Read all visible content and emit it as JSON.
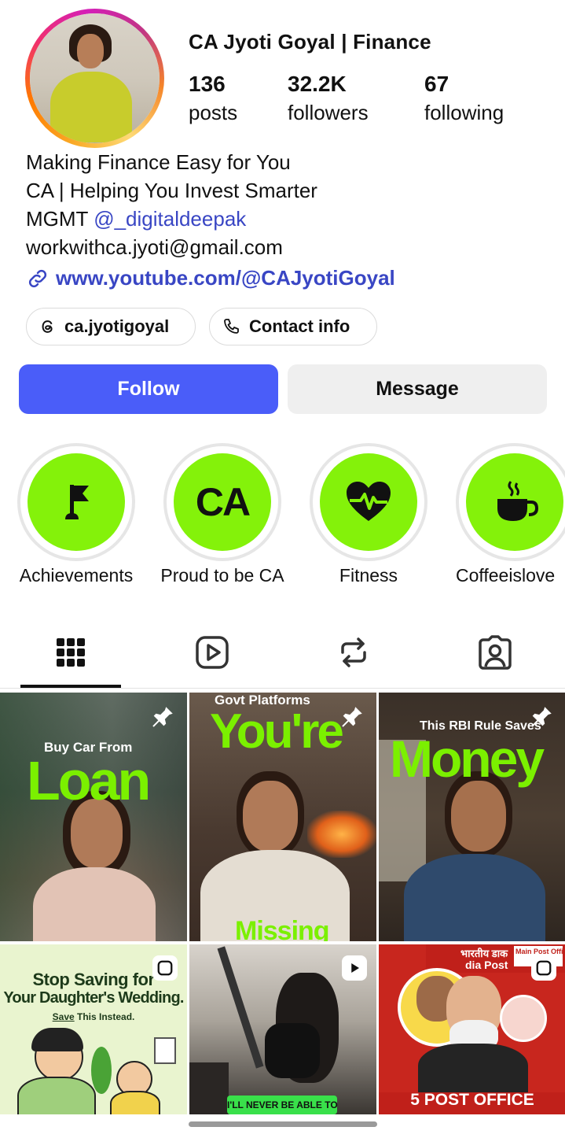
{
  "profile": {
    "name": "CA Jyoti Goyal | Finance",
    "stats": [
      {
        "value": "136",
        "label": "posts"
      },
      {
        "value": "32.2K",
        "label": "followers"
      },
      {
        "value": "67",
        "label": "following"
      }
    ],
    "bio_line1": "Making Finance Easy for You",
    "bio_line2": "CA | Helping You Invest Smarter",
    "bio_mgmt_prefix": "MGMT ",
    "bio_mention": "@_digitaldeepak",
    "bio_email": "workwithca.jyoti@gmail.com",
    "link": "www.youtube.com/@CAJyotiGoyal",
    "threads_handle": "ca.jyotigoyal",
    "contact_label": "Contact info"
  },
  "actions": {
    "follow": "Follow",
    "message": "Message"
  },
  "highlights": [
    {
      "label": "Achievements",
      "icon": "flag-icon"
    },
    {
      "label": "Proud to be CA",
      "icon": "CA"
    },
    {
      "label": "Fitness",
      "icon": "heart-pulse-icon"
    },
    {
      "label": "Coffeeislove",
      "icon": "coffee-cup-icon"
    }
  ],
  "tabs": [
    "grid-icon",
    "reels-icon",
    "reposts-icon",
    "tagged-icon"
  ],
  "posts": [
    {
      "kicker": "Buy Car From",
      "headline": "Loan",
      "pinned": true
    },
    {
      "kicker": "Govt Platforms",
      "headline": "You're",
      "footer": "Missing",
      "pinned": true
    },
    {
      "kicker": "This RBI Rule Saves",
      "headline": "Money",
      "pinned": true
    },
    {
      "line1": "Stop Saving for",
      "line2": "Your Daughter's Wedding.",
      "line3_u": "Save",
      "line3": " This Instead.",
      "type": "reel"
    },
    {
      "caption": "I'LL NEVER BE ABLE TO",
      "type": "reel"
    },
    {
      "sign1": "भारतीय डाक",
      "sign2": "dia Post",
      "sign3": "Main Post Office",
      "headline": "5 POST OFFICE",
      "type": "reel"
    }
  ],
  "colors": {
    "accent": "#4a5df9",
    "link": "#3946c4",
    "highlight_green": "#84f20a"
  }
}
